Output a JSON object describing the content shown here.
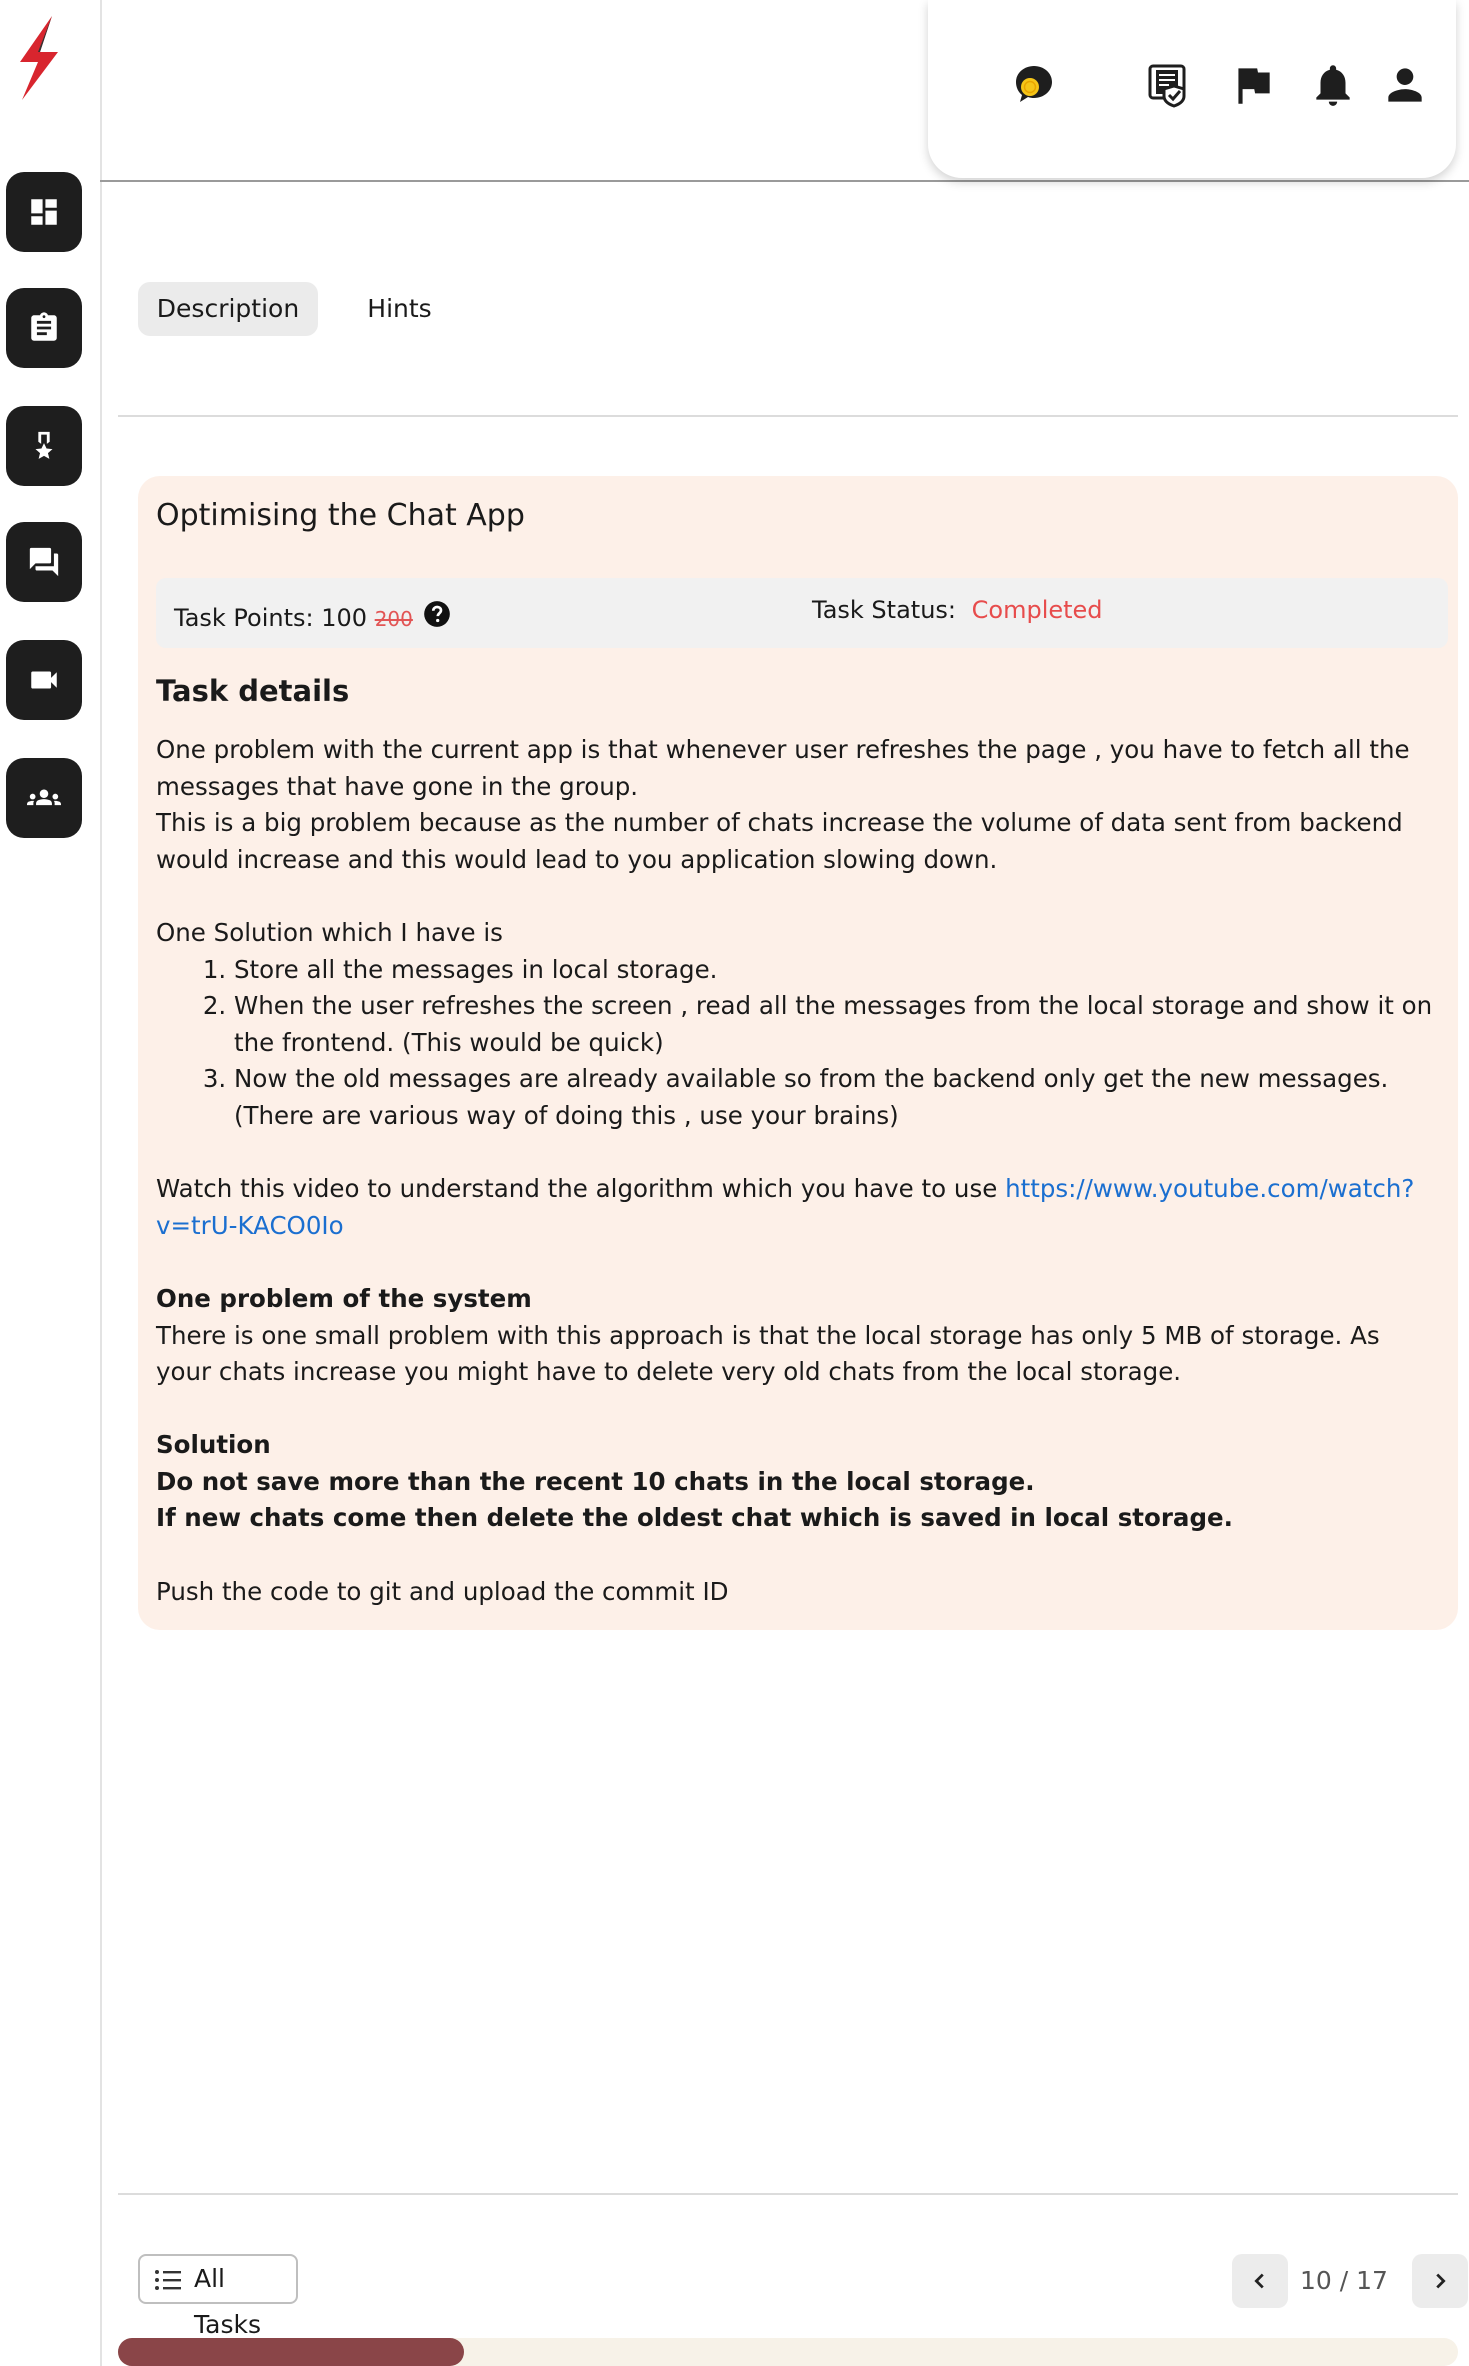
{
  "colors": {
    "accent_red": "#e74c4c",
    "link": "#1b6fd0",
    "card_bg": "#fdf0e8",
    "progress": "#8a4548",
    "sidebar_btn": "#1e1e1e"
  },
  "sidebar": {
    "items": [
      {
        "name": "dashboard",
        "icon": "dashboard-icon"
      },
      {
        "name": "tasks",
        "icon": "clipboard-icon"
      },
      {
        "name": "achievements",
        "icon": "medal-icon"
      },
      {
        "name": "forum",
        "icon": "chat-icon"
      },
      {
        "name": "video",
        "icon": "video-camera-icon"
      },
      {
        "name": "community",
        "icon": "people-icon"
      }
    ]
  },
  "header": {
    "icons": [
      "chat-coin-icon",
      "certificate-icon",
      "flag-icon",
      "bell-icon",
      "user-icon"
    ]
  },
  "tabs": [
    {
      "label": "Description",
      "active": true
    },
    {
      "label": "Hints",
      "active": false
    }
  ],
  "task": {
    "title": "Optimising the Chat App",
    "points_label": "Task Points: 100",
    "points_old": "200",
    "status_label": "Task Status:",
    "status_value": "Completed",
    "details_title": "Task details",
    "p1": "One problem with the current app is that whenever user refreshes the page , you have to fetch all the messages that have gone in the group.",
    "p2": "This is a big problem because as the number of chats increase the volume of data sent from backend would increase and this would lead to you application slowing down.",
    "p3": "One Solution which I have is",
    "steps": [
      "Store all the messages in local storage.",
      "When the user refreshes the screen , read all the messages from the local storage and show it on the frontend. (This would be quick)",
      "Now the old messages are already available so from the backend only get the new messages. (There are various way of doing this , use your brains)"
    ],
    "video_text": "Watch this video to understand the algorithm which you have to use ",
    "video_link": "https://www.youtube.com/watch?v=trU-KACO0Io",
    "problem_title": "One problem of the system",
    "problem_text": "There is one small problem with this approach is that the local storage has only 5 MB of storage. As your chats increase you might have to delete very old chats from the local storage.",
    "solution_title": "Solution",
    "solution_1": "Do not save more than the recent 10 chats in the local storage.",
    "solution_2": "If new chats come then delete the oldest chat which is saved in local storage.",
    "push_text": "Push the code to git and upload the commit ID"
  },
  "footer": {
    "all_tasks_label": "All Tasks",
    "page_indicator": "10 / 17",
    "progress_fraction": 0.258
  }
}
